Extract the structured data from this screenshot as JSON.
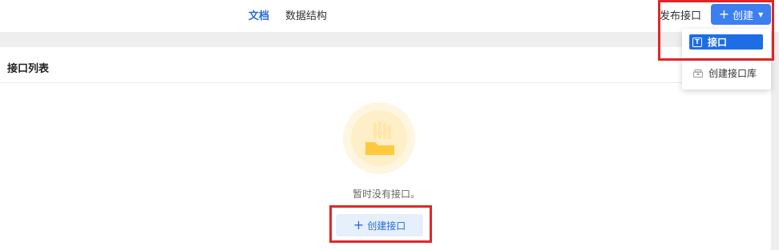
{
  "tabs": [
    {
      "label": "文档",
      "active": true
    },
    {
      "label": "数据结构",
      "active": false
    }
  ],
  "header": {
    "publish_label": "发布接口",
    "create_label": "创建",
    "create_plus": "+",
    "create_caret": "▼"
  },
  "dropdown": {
    "item1_label": "接口",
    "item1_icon_text": "T",
    "item2_label": "创建接口库"
  },
  "section": {
    "title": "接口列表"
  },
  "empty_state": {
    "message": "暂时没有接口。",
    "button_plus": "+",
    "button_label": "创建接口"
  },
  "colors": {
    "accent": "#3b7ff0",
    "active_tab": "#2a6cd6",
    "highlight": "#e0262a"
  }
}
